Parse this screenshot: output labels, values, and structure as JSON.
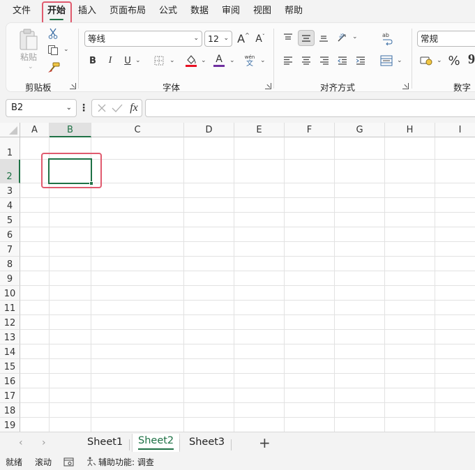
{
  "menu": {
    "tabs": [
      "文件",
      "开始",
      "插入",
      "页面布局",
      "公式",
      "数据",
      "审阅",
      "视图",
      "帮助"
    ],
    "active": "开始"
  },
  "ribbon": {
    "clipboard": {
      "label": "剪贴板",
      "paste_label": "粘贴"
    },
    "font": {
      "label": "字体",
      "font_name": "等线",
      "font_size": "12",
      "grow_font": "A",
      "shrink_font": "A",
      "bold": "B",
      "italic": "I",
      "underline": "U",
      "phonetic_top": "wén",
      "phonetic_bottom": "文",
      "font_color_letter": "A",
      "fill_color": "#e81123",
      "font_color": "#7030a0"
    },
    "alignment": {
      "label": "对齐方式"
    },
    "number": {
      "label": "数字",
      "format": "常规",
      "percent": "%",
      "comma": "9"
    }
  },
  "formula_bar": {
    "name_box": "B2",
    "fx": "fx",
    "formula": ""
  },
  "grid": {
    "columns": [
      "A",
      "B",
      "C",
      "D",
      "E",
      "F",
      "G",
      "H",
      "I"
    ],
    "rows": [
      "1",
      "2",
      "3",
      "4",
      "5",
      "6",
      "7",
      "8",
      "9",
      "10",
      "11",
      "12",
      "13",
      "14",
      "15",
      "16",
      "17",
      "18",
      "19"
    ],
    "selected_cell": "B2",
    "accent": "#1e7145"
  },
  "sheets": {
    "tabs": [
      "Sheet1",
      "Sheet2",
      "Sheet3"
    ],
    "active": "Sheet2",
    "add": "+"
  },
  "status": {
    "ready": "就绪",
    "scroll": "滚动",
    "accessibility": "辅助功能: 调查"
  }
}
